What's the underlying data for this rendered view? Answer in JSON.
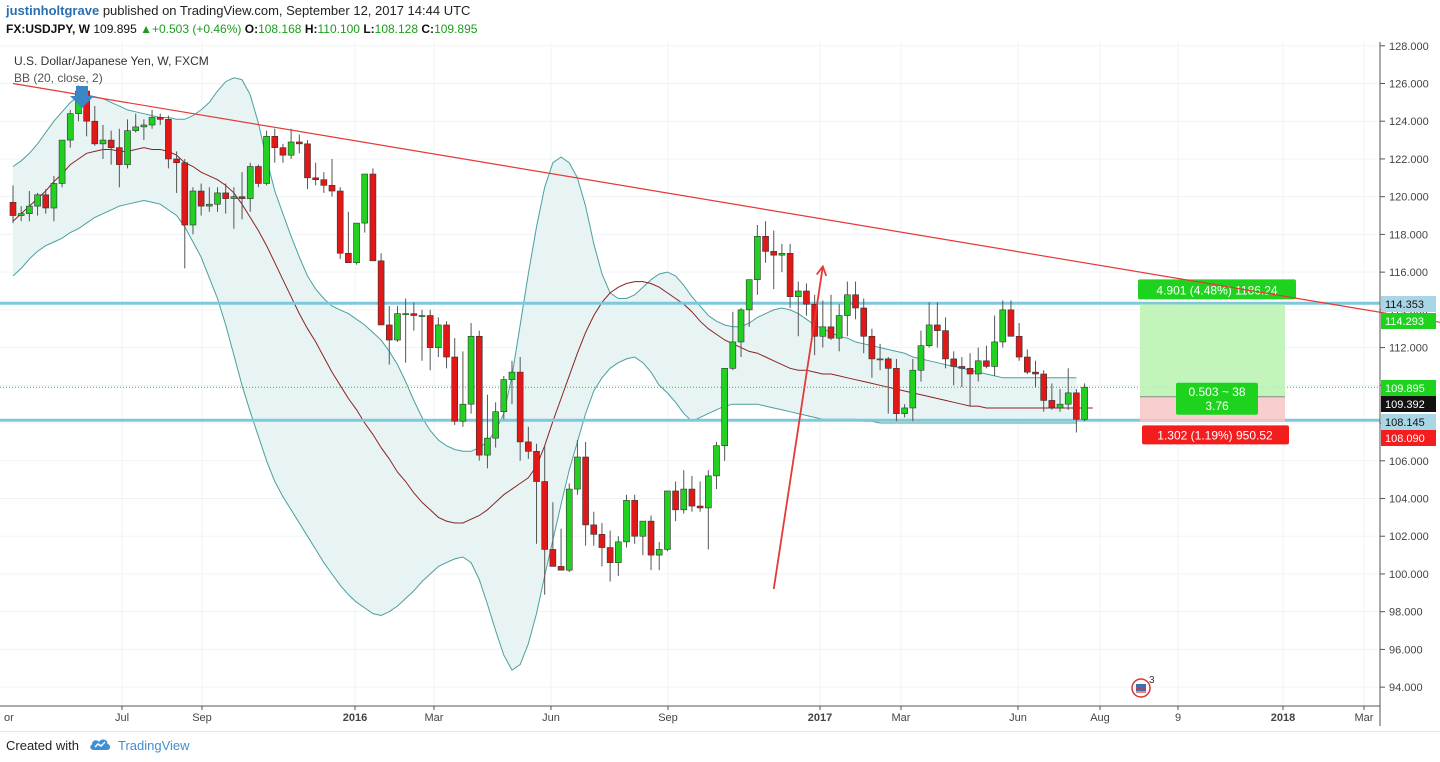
{
  "header": {
    "author": "justinholtgrave",
    "published": "published on TradingView.com, September 12, 2017 14:44 UTC",
    "symbol": "FX:USDJPY, W",
    "last": "109.895",
    "change": "+0.503 (+0.46%)",
    "open_label": "O:",
    "open": "108.168",
    "high_label": "H:",
    "high": "110.100",
    "low_label": "L:",
    "low": "108.128",
    "close_label": "C:",
    "close": "109.895"
  },
  "legend": {
    "instrument": "U.S. Dollar/Japanese Yen, W, FXCM",
    "indicator": "BB (20, close, 2)"
  },
  "footer": {
    "created": "Created with",
    "brand": "TradingView"
  },
  "colors": {
    "up": "#22d022",
    "down": "#e01818",
    "wick": "#555555",
    "band": "#4a9fa0",
    "band_fill": "#e8f4f4",
    "basis": "#8b2323",
    "trendline": "#e53935",
    "support": "#7ec8dc",
    "accent": "#2a6fb0"
  },
  "chart_data": {
    "type": "candlestick",
    "title": "U.S. Dollar/Japanese Yen, W, FXCM",
    "ylim": [
      93,
      128.2
    ],
    "y_ticks": [
      "128.000",
      "126.000",
      "124.000",
      "122.000",
      "120.000",
      "118.000",
      "116.000",
      "114.000",
      "112.000",
      "110.000",
      "108.000",
      "106.000",
      "104.000",
      "102.000",
      "100.000",
      "98.000",
      "96.000",
      "94.000"
    ],
    "x_ticks": [
      "Jul",
      "Sep",
      "2016",
      "Mar",
      "Jun",
      "Sep",
      "2017",
      "Mar",
      "Jun",
      "Aug",
      "9",
      "2018",
      "Mar"
    ],
    "x_ticks_first_partial": "or",
    "ohlc": [
      [
        119.7,
        120.6,
        118.6,
        119.0
      ],
      [
        119.0,
        119.5,
        118.7,
        119.1
      ],
      [
        119.1,
        120.3,
        118.7,
        119.5
      ],
      [
        119.5,
        120.2,
        119.0,
        120.1
      ],
      [
        120.1,
        120.4,
        119.1,
        119.4
      ],
      [
        119.4,
        121.1,
        118.7,
        120.7
      ],
      [
        120.7,
        122.8,
        120.5,
        123.0
      ],
      [
        123.0,
        124.6,
        122.6,
        124.4
      ],
      [
        124.4,
        125.9,
        124.0,
        125.6
      ],
      [
        125.6,
        125.8,
        123.2,
        124.0
      ],
      [
        124.0,
        124.8,
        122.7,
        122.8
      ],
      [
        122.8,
        123.8,
        122.0,
        123.0
      ],
      [
        123.0,
        123.5,
        121.7,
        122.6
      ],
      [
        122.6,
        123.6,
        120.5,
        121.7
      ],
      [
        121.7,
        124.1,
        121.5,
        123.5
      ],
      [
        123.5,
        124.4,
        123.4,
        123.7
      ],
      [
        123.7,
        124.1,
        123.0,
        123.8
      ],
      [
        123.8,
        124.6,
        123.6,
        124.2
      ],
      [
        124.2,
        124.4,
        123.8,
        124.1
      ],
      [
        124.1,
        124.3,
        121.5,
        122.0
      ],
      [
        122.0,
        122.4,
        120.2,
        121.8
      ],
      [
        121.8,
        122.0,
        116.2,
        118.5
      ],
      [
        118.5,
        120.5,
        118.0,
        120.3
      ],
      [
        120.3,
        120.7,
        119.0,
        119.5
      ],
      [
        119.5,
        120.5,
        119.2,
        119.6
      ],
      [
        119.6,
        120.5,
        119.2,
        120.2
      ],
      [
        120.2,
        120.7,
        119.1,
        119.9
      ],
      [
        119.9,
        120.5,
        118.3,
        120.0
      ],
      [
        120.0,
        121.3,
        118.8,
        119.9
      ],
      [
        119.9,
        121.8,
        119.2,
        121.6
      ],
      [
        121.6,
        121.7,
        120.5,
        120.7
      ],
      [
        120.7,
        123.5,
        120.6,
        123.2
      ],
      [
        123.2,
        123.6,
        121.8,
        122.6
      ],
      [
        122.6,
        122.8,
        121.8,
        122.2
      ],
      [
        122.2,
        123.6,
        122.0,
        122.9
      ],
      [
        122.9,
        123.3,
        122.3,
        122.8
      ],
      [
        122.8,
        123.0,
        120.4,
        121.0
      ],
      [
        121.0,
        121.8,
        120.6,
        120.9
      ],
      [
        120.9,
        121.3,
        120.2,
        120.6
      ],
      [
        120.6,
        122.0,
        120.0,
        120.3
      ],
      [
        120.3,
        120.5,
        116.7,
        117.0
      ],
      [
        117.0,
        119.2,
        116.5,
        116.5
      ],
      [
        116.5,
        118.3,
        116.4,
        118.6
      ],
      [
        118.6,
        121.0,
        118.1,
        121.2
      ],
      [
        121.2,
        121.5,
        116.8,
        116.6
      ],
      [
        116.6,
        117.0,
        113.2,
        113.2
      ],
      [
        113.2,
        114.2,
        111.1,
        112.4
      ],
      [
        112.4,
        114.2,
        112.3,
        113.8
      ],
      [
        113.8,
        114.6,
        111.2,
        113.8
      ],
      [
        113.8,
        114.4,
        112.9,
        113.7
      ],
      [
        113.7,
        114.0,
        111.3,
        113.7
      ],
      [
        113.7,
        114.0,
        110.8,
        112.0
      ],
      [
        112.0,
        113.6,
        111.5,
        113.2
      ],
      [
        113.2,
        113.4,
        110.9,
        111.5
      ],
      [
        111.5,
        112.5,
        107.9,
        108.1
      ],
      [
        108.1,
        111.8,
        107.8,
        109.0
      ],
      [
        109.0,
        113.3,
        108.5,
        112.6
      ],
      [
        112.6,
        112.9,
        106.0,
        106.3
      ],
      [
        106.3,
        109.5,
        105.6,
        107.2
      ],
      [
        107.2,
        109.1,
        106.7,
        108.6
      ],
      [
        108.6,
        110.5,
        108.2,
        110.3
      ],
      [
        110.3,
        111.3,
        109.0,
        110.7
      ],
      [
        110.7,
        111.5,
        106.0,
        107.0
      ],
      [
        107.0,
        107.8,
        106.1,
        106.5
      ],
      [
        106.5,
        106.9,
        101.6,
        104.9
      ],
      [
        104.9,
        106.8,
        98.9,
        101.3
      ],
      [
        101.3,
        103.8,
        100.9,
        100.4
      ],
      [
        100.4,
        102.4,
        100.2,
        100.2
      ],
      [
        100.2,
        104.8,
        100.1,
        104.5
      ],
      [
        104.5,
        107.1,
        104.2,
        106.2
      ],
      [
        106.2,
        107.0,
        101.5,
        102.6
      ],
      [
        102.6,
        103.3,
        101.5,
        102.1
      ],
      [
        102.1,
        102.7,
        100.4,
        101.4
      ],
      [
        101.4,
        102.3,
        99.6,
        100.6
      ],
      [
        100.6,
        102.0,
        99.9,
        101.7
      ],
      [
        101.7,
        104.2,
        101.4,
        103.9
      ],
      [
        103.9,
        104.2,
        101.6,
        102.0
      ],
      [
        102.0,
        102.6,
        101.0,
        102.8
      ],
      [
        102.8,
        103.1,
        100.2,
        101.0
      ],
      [
        101.0,
        101.7,
        100.2,
        101.3
      ],
      [
        101.3,
        104.0,
        101.2,
        104.4
      ],
      [
        104.4,
        104.9,
        102.8,
        103.4
      ],
      [
        103.4,
        105.5,
        103.2,
        104.5
      ],
      [
        104.5,
        105.2,
        103.3,
        103.6
      ],
      [
        103.6,
        104.9,
        103.3,
        103.5
      ],
      [
        103.5,
        105.5,
        101.3,
        105.2
      ],
      [
        105.2,
        107.0,
        104.5,
        106.8
      ],
      [
        106.8,
        110.3,
        106.0,
        110.9
      ],
      [
        110.9,
        113.9,
        110.8,
        112.3
      ],
      [
        112.3,
        114.1,
        111.5,
        114.0
      ],
      [
        114.0,
        115.5,
        113.1,
        115.6
      ],
      [
        115.6,
        118.5,
        114.8,
        117.9
      ],
      [
        117.9,
        118.7,
        116.5,
        117.1
      ],
      [
        117.1,
        118.2,
        115.1,
        116.9
      ],
      [
        116.9,
        117.5,
        116.0,
        117.0
      ],
      [
        117.0,
        117.5,
        114.1,
        114.7
      ],
      [
        114.7,
        115.5,
        112.6,
        115.0
      ],
      [
        115.0,
        115.4,
        113.7,
        114.3
      ],
      [
        114.3,
        114.8,
        111.6,
        112.6
      ],
      [
        112.6,
        114.5,
        112.0,
        113.1
      ],
      [
        113.1,
        114.8,
        112.4,
        112.5
      ],
      [
        112.5,
        114.3,
        111.8,
        113.7
      ],
      [
        113.7,
        115.5,
        112.6,
        114.8
      ],
      [
        114.8,
        115.5,
        113.5,
        114.1
      ],
      [
        114.1,
        114.6,
        111.7,
        112.6
      ],
      [
        112.6,
        113.0,
        110.4,
        111.4
      ],
      [
        111.4,
        112.2,
        110.8,
        111.4
      ],
      [
        111.4,
        111.5,
        108.5,
        110.9
      ],
      [
        110.9,
        111.4,
        108.1,
        108.5
      ],
      [
        108.5,
        109.0,
        108.3,
        108.8
      ],
      [
        108.8,
        111.4,
        108.1,
        110.8
      ],
      [
        110.8,
        112.9,
        110.2,
        112.1
      ],
      [
        112.1,
        114.4,
        112.0,
        113.2
      ],
      [
        113.2,
        114.4,
        112.0,
        112.9
      ],
      [
        112.9,
        113.6,
        110.9,
        111.4
      ],
      [
        111.4,
        111.8,
        110.0,
        111.0
      ],
      [
        111.0,
        111.5,
        109.9,
        110.9
      ],
      [
        110.9,
        111.7,
        108.9,
        110.6
      ],
      [
        110.6,
        112.0,
        110.2,
        111.3
      ],
      [
        111.3,
        112.1,
        110.9,
        111.0
      ],
      [
        111.0,
        113.7,
        110.5,
        112.3
      ],
      [
        112.3,
        114.5,
        112.0,
        114.0
      ],
      [
        114.0,
        114.5,
        112.7,
        112.6
      ],
      [
        112.6,
        113.3,
        111.3,
        111.5
      ],
      [
        111.5,
        111.9,
        110.6,
        110.7
      ],
      [
        110.7,
        111.3,
        109.9,
        110.6
      ],
      [
        110.6,
        110.8,
        108.6,
        109.2
      ],
      [
        109.2,
        110.1,
        108.7,
        108.8
      ],
      [
        108.8,
        109.8,
        108.6,
        109.0
      ],
      [
        109.0,
        110.9,
        108.7,
        109.6
      ],
      [
        109.6,
        109.8,
        107.5,
        108.2
      ],
      [
        108.2,
        110.1,
        108.1,
        109.9
      ]
    ],
    "bollinger": {
      "basis": [
        118.7,
        119.1,
        119.5,
        119.9,
        120.3,
        120.8,
        121.2,
        121.7,
        122.0,
        122.3,
        122.4,
        122.5,
        122.5,
        122.4,
        122.4,
        122.5,
        122.6,
        122.5,
        122.5,
        122.4,
        122.2,
        121.8,
        121.6,
        121.3,
        121.1,
        120.9,
        120.6,
        120.2,
        119.6,
        118.9,
        118.2,
        117.4,
        116.5,
        115.6,
        114.7,
        113.8,
        113.0,
        112.3,
        111.5,
        110.7,
        110.0,
        109.3,
        108.7,
        108.0,
        107.4,
        106.7,
        106.1,
        105.4,
        104.9,
        104.3,
        103.8,
        103.4,
        103.0,
        102.8,
        102.7,
        102.7,
        102.9,
        103.1,
        103.4,
        103.8,
        104.2,
        104.5,
        104.8,
        105.1,
        105.7,
        106.8,
        108.1,
        109.3,
        110.5,
        111.7,
        112.8,
        113.7,
        114.4,
        114.9,
        115.2,
        115.4,
        115.5,
        115.5,
        115.4,
        115.2,
        114.9,
        114.6,
        114.3,
        113.9,
        113.4,
        113.0,
        112.7,
        112.4,
        112.2,
        112.0,
        111.8,
        111.7,
        111.5,
        111.3,
        111.1,
        110.9,
        110.8,
        110.8,
        110.7,
        110.6,
        110.6,
        110.5,
        110.4,
        110.3,
        110.2,
        110.1,
        110.0,
        109.9,
        109.8,
        109.7,
        109.6,
        109.5,
        109.4,
        109.3,
        109.2,
        109.1,
        109.0,
        108.9,
        108.9,
        108.8,
        108.8,
        108.8,
        108.8,
        108.8,
        108.8,
        108.8,
        108.8,
        108.8,
        108.8,
        108.8,
        108.8,
        108.8,
        108.8
      ],
      "upper": [
        121.6,
        121.9,
        122.3,
        122.8,
        123.4,
        124.0,
        124.5,
        125.0,
        125.3,
        125.4,
        125.3,
        125.2,
        125.0,
        124.8,
        124.6,
        124.5,
        124.4,
        124.3,
        124.2,
        124.2,
        124.1,
        124.1,
        124.3,
        124.6,
        125.0,
        125.6,
        126.1,
        126.3,
        126.2,
        125.4,
        123.9,
        122.0,
        120.3,
        119.1,
        117.9,
        116.8,
        115.8,
        115.1,
        114.6,
        114.2,
        114.0,
        113.8,
        113.5,
        113.2,
        112.8,
        112.4,
        111.8,
        111.1,
        110.2,
        109.2,
        108.3,
        107.6,
        107.1,
        106.8,
        106.6,
        106.5,
        106.5,
        106.7,
        107.0,
        107.6,
        108.5,
        110.5,
        113.2,
        115.9,
        118.4,
        120.5,
        121.8,
        122.1,
        121.8,
        121.0,
        119.5,
        117.5,
        115.9,
        114.9,
        114.6,
        114.6,
        114.8,
        115.2,
        115.6,
        115.9,
        116.0,
        115.8,
        115.3,
        114.7,
        114.2,
        113.7,
        113.4,
        113.2,
        113.1,
        113.1,
        113.3,
        113.6,
        113.8,
        114.0,
        114.1,
        114.0,
        113.8,
        113.5,
        113.2,
        113.0,
        112.8,
        112.6,
        112.5,
        112.3,
        112.2,
        112.1,
        112.0,
        111.9,
        111.8,
        111.7,
        111.5,
        111.4,
        111.3,
        111.2,
        111.1,
        111.0,
        110.9,
        110.8,
        110.7,
        110.6,
        110.5,
        110.4,
        110.4,
        110.4,
        110.4,
        110.4,
        110.4,
        110.4,
        110.4,
        110.4,
        110.4
      ],
      "lower": [
        115.8,
        116.2,
        116.7,
        117.1,
        117.4,
        117.6,
        117.8,
        118.1,
        118.3,
        118.6,
        118.9,
        119.1,
        119.3,
        119.5,
        119.6,
        119.7,
        119.8,
        119.7,
        119.6,
        119.3,
        119.0,
        118.4,
        117.6,
        116.8,
        115.7,
        114.6,
        113.2,
        111.6,
        110.0,
        108.6,
        107.3,
        106.0,
        104.9,
        104.1,
        103.4,
        102.7,
        102.0,
        101.3,
        100.6,
        100.0,
        99.4,
        98.9,
        98.5,
        98.2,
        97.9,
        97.8,
        98.0,
        98.3,
        98.7,
        99.1,
        99.6,
        100.0,
        100.4,
        100.6,
        100.8,
        100.9,
        100.6,
        99.7,
        98.4,
        97.0,
        95.7,
        94.9,
        95.2,
        96.3,
        97.9,
        99.9,
        101.8,
        103.7,
        105.5,
        107.0,
        108.5,
        109.7,
        110.4,
        110.9,
        111.2,
        111.4,
        111.5,
        111.2,
        110.7,
        110.0,
        109.6,
        109.1,
        108.5,
        108.1,
        108.3,
        108.5,
        108.7,
        108.9,
        109.0,
        109.0,
        109.0,
        109.0,
        108.9,
        108.8,
        108.7,
        108.6,
        108.5,
        108.4,
        108.3,
        108.2,
        108.2,
        108.2,
        108.2,
        108.2,
        108.1,
        108.1,
        108.0,
        108.0,
        108.0,
        108.0,
        108.0,
        108.0,
        108.0,
        108.0,
        108.0,
        108.0,
        108.0,
        108.0,
        108.0,
        108.0,
        108.0,
        108.0,
        108.0,
        108.0,
        108.0,
        108.0,
        108.0,
        108.0,
        108.0,
        108.0,
        108.0
      ]
    },
    "trendline": {
      "from": [
        0,
        126.0
      ],
      "to": [
        175,
        113.3
      ]
    },
    "arrow_annotation": {
      "from": [
        93,
        99.2
      ],
      "to": [
        99,
        116.3
      ]
    },
    "horizontal_levels": [
      114.353,
      108.145
    ],
    "last_price": 109.895,
    "position": {
      "entry": 109.392,
      "target": 114.293,
      "stop": 108.09,
      "target_label": "4.901 (4.48%) 1186.24",
      "ratio_label_1": "0.503 ~ 38",
      "ratio_label_2": "3.76",
      "stop_label": "1.302 (1.19%) 950.52"
    },
    "price_labels": [
      {
        "text": "114.353",
        "value": 114.353,
        "kind": "level"
      },
      {
        "text": "114.293",
        "value": 114.293,
        "kind": "target"
      },
      {
        "text": "109.895",
        "value": 109.895,
        "kind": "last"
      },
      {
        "text": "109.392",
        "value": 109.392,
        "kind": "entry"
      },
      {
        "text": "108.145",
        "value": 108.145,
        "kind": "level"
      },
      {
        "text": "108.090",
        "value": 108.09,
        "kind": "stop"
      }
    ],
    "events_badge": "3"
  }
}
